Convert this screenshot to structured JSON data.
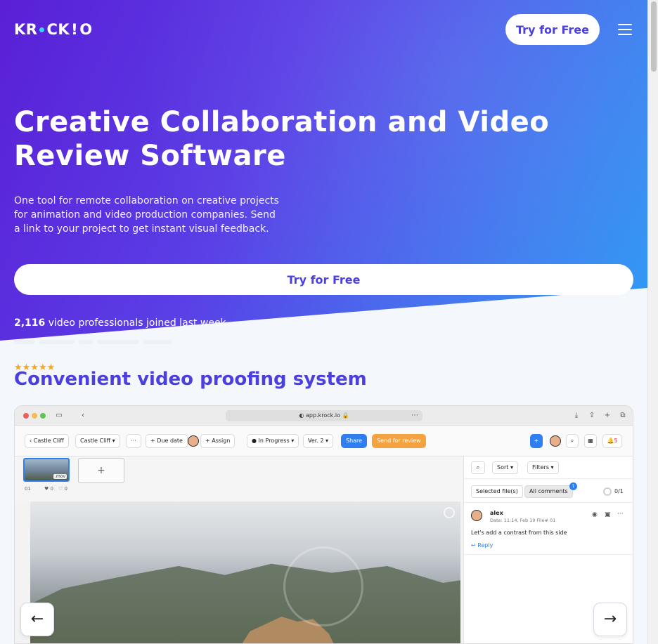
{
  "brand": {
    "logo_text_left": "KR",
    "logo_text_mid": "CK",
    "logo_text_right": "O"
  },
  "nav": {
    "cta_label": "Try for Free",
    "menu_icon": "hamburger-icon"
  },
  "hero": {
    "title_line1": "Creative Collaboration and Video",
    "title_line2": "Review Software",
    "subtitle": "One tool for remote collaboration on creative projects for animation and video production companies. Send a link to your project to get instant visual feedback.",
    "cta_label": "Try for Free",
    "joined_count": "2,116",
    "joined_text": "video professionals joined last week"
  },
  "section": {
    "stars": "★★★★★",
    "title": "Convenient video proofing system"
  },
  "app": {
    "url": "app.krock.io",
    "toolbar": {
      "back_label": "Castle Cliff",
      "project_label": "Castle Cliff ▾",
      "more_label": "···",
      "due_label": "+ Due date",
      "assign_label": "+ Assign",
      "status_label": "In Progress ▾",
      "version_label": "Ver. 2 ▾",
      "share_label": "Share",
      "review_label": "Send for review",
      "notif_count": "5"
    },
    "thumbnail": {
      "ext": ".mov",
      "index": "01",
      "likes": "♥ 0",
      "comments": "♡ 0"
    },
    "add_label": "+",
    "panel": {
      "sort_label": "Sort ▾",
      "filters_label": "Filters ▾",
      "selected_label": "Selected file(s)",
      "all_comments_label": "All comments",
      "all_comments_badge": "1",
      "progress": "0/1",
      "comment": {
        "author": "alex",
        "meta": "Date: 11:14, Feb 10     File# 01",
        "text": "Let's add a contrast from this side",
        "reply_label": "Reply"
      }
    }
  },
  "carousel": {
    "prev_icon": "←",
    "next_icon": "→"
  },
  "colors": {
    "brand": "#4b3fe0",
    "accent_blue": "#2f7ff0",
    "accent_orange": "#f4a340"
  }
}
